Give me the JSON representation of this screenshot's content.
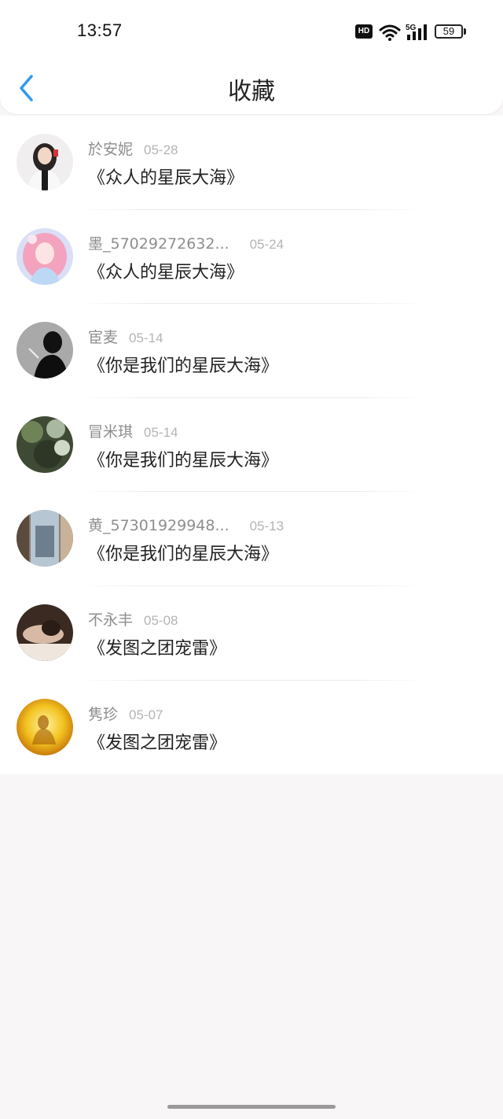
{
  "status_bar": {
    "time": "13:57",
    "hd_label": "HD",
    "network_label": "5G",
    "battery_level": "59"
  },
  "header": {
    "title": "收藏",
    "back_icon": "chevron-left-icon",
    "accent_color": "#2f9af0"
  },
  "items": [
    {
      "user": "於安妮",
      "date": "05-28",
      "title": "《众人的星辰大海》"
    },
    {
      "user": "墨_57029272632...",
      "date": "05-24",
      "title": "《众人的星辰大海》"
    },
    {
      "user": "宦麦",
      "date": "05-14",
      "title": "《你是我们的星辰大海》"
    },
    {
      "user": "冒米琪",
      "date": "05-14",
      "title": "《你是我们的星辰大海》"
    },
    {
      "user": "黄_57301929948...",
      "date": "05-13",
      "title": "《你是我们的星辰大海》"
    },
    {
      "user": "不永丰",
      "date": "05-08",
      "title": "《发图之团宠雷》"
    },
    {
      "user": "隽珍",
      "date": "05-07",
      "title": "《发图之团宠雷》"
    }
  ]
}
